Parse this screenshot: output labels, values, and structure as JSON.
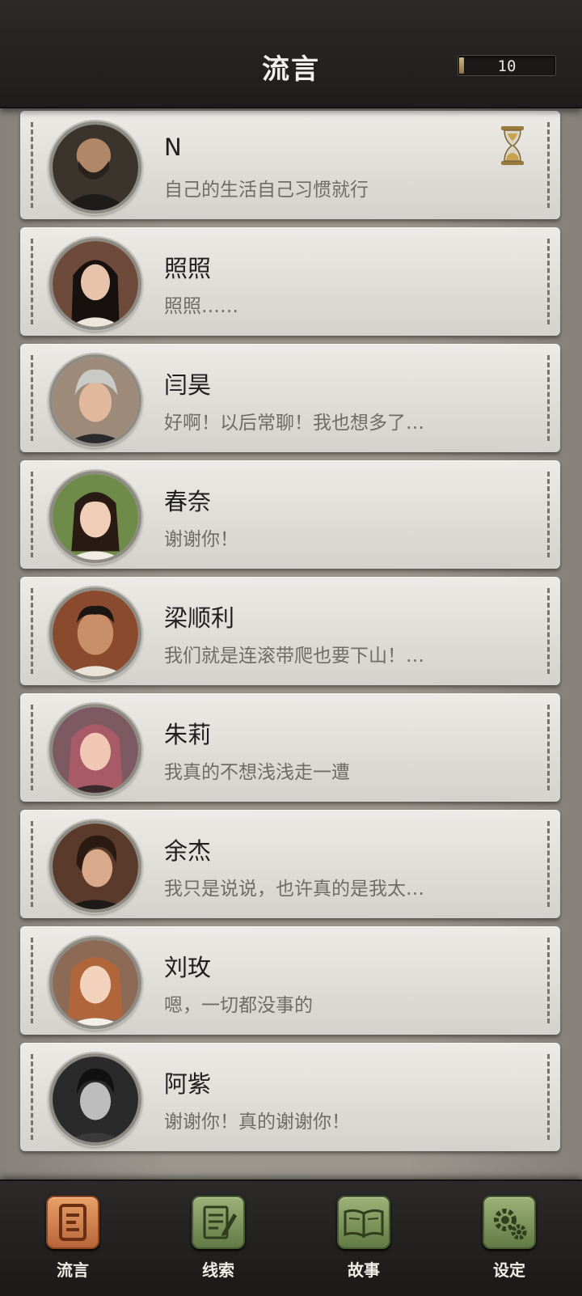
{
  "header": {
    "title": "流言",
    "counter": "10"
  },
  "contacts": [
    {
      "name": "N",
      "message": "自己的生活自己习惯就行"
    },
    {
      "name": "照照",
      "message": "照照……"
    },
    {
      "name": "闫昊",
      "message": "好啊！以后常聊！我也想多了…"
    },
    {
      "name": "春奈",
      "message": "谢谢你！"
    },
    {
      "name": "梁顺利",
      "message": "我们就是连滚带爬也要下山！…"
    },
    {
      "name": "朱莉",
      "message": "我真的不想浅浅走一遭"
    },
    {
      "name": "余杰",
      "message": "我只是说说，也许真的是我太…"
    },
    {
      "name": "刘玫",
      "message": "嗯，一切都没事的"
    },
    {
      "name": "阿紫",
      "message": "谢谢你！真的谢谢你！"
    }
  ],
  "nav": [
    {
      "label": "流言",
      "icon": "rumor-icon",
      "active": true
    },
    {
      "label": "线索",
      "icon": "clue-notepad-icon",
      "active": false
    },
    {
      "label": "故事",
      "icon": "story-book-icon",
      "active": false
    },
    {
      "label": "设定",
      "icon": "settings-gear-icon",
      "active": false
    }
  ],
  "colors": {
    "active_tab": "#d98b52",
    "inactive_tab": "#7f9659",
    "card": "#e3e1dc",
    "bar": "#252321"
  }
}
